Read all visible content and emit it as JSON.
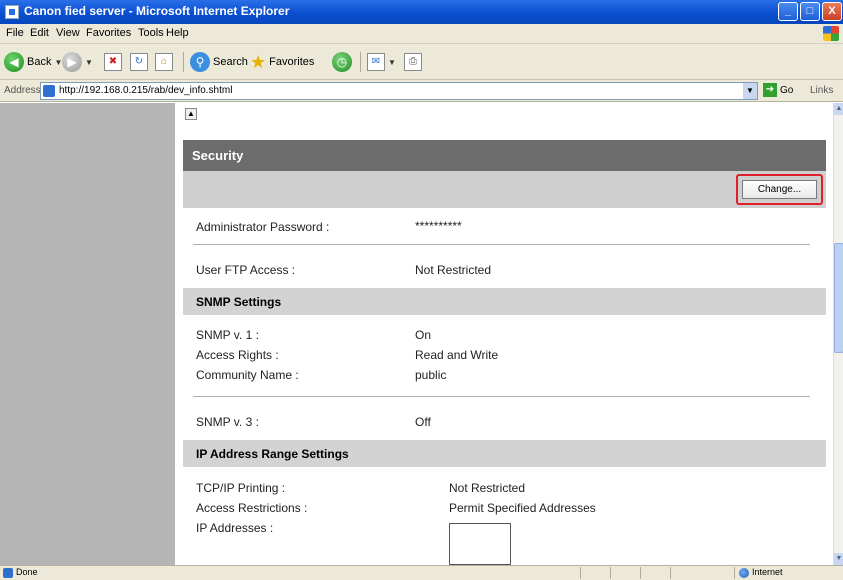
{
  "window": {
    "title": "Canon fied server - Microsoft Internet Explorer",
    "controls": {
      "minimize": "_",
      "maximize": "□",
      "close": "X"
    }
  },
  "menu": [
    "File",
    "Edit",
    "View",
    "Favorites",
    "Tools",
    "Help"
  ],
  "toolbar": {
    "back_label": "Back",
    "search_label": "Search",
    "favorites_label": "Favorites"
  },
  "address": {
    "label": "Address",
    "url": "http://192.168.0.215/rab/dev_info.shtml",
    "go_label": "Go",
    "links_label": "Links"
  },
  "page": {
    "section_title": "Security",
    "change_button": "Change...",
    "admin_password_label": "Administrator Password :",
    "admin_password_value": "**********",
    "ftp_label": "User FTP Access :",
    "ftp_value": "Not Restricted",
    "snmp_header": "SNMP Settings",
    "snmp_v1_label": "SNMP v. 1 :",
    "snmp_v1_value": "On",
    "access_rights_label": "Access Rights :",
    "access_rights_value": "Read and Write",
    "community_label": "Community Name :",
    "community_value": "public",
    "snmp_v3_label": "SNMP v. 3 :",
    "snmp_v3_value": "Off",
    "ip_header": "IP Address Range Settings",
    "tcpip_label": "TCP/IP Printing :",
    "tcpip_value": "Not Restricted",
    "access_restrictions_label": "Access Restrictions :",
    "access_restrictions_value": "Permit Specified Addresses",
    "ip_addresses_label": "IP Addresses :"
  },
  "status": {
    "text": "Done",
    "zone": "Internet"
  },
  "colors": {
    "highlight": "#e0202a",
    "section_header": "#6c6c6c",
    "left_panel": "#b5b5b5"
  }
}
